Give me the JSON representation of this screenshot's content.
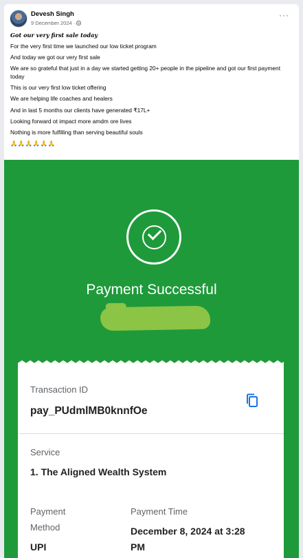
{
  "post": {
    "author": "Devesh Singh",
    "date": "9 December 2024",
    "separator": "·",
    "more_label": "···",
    "lines": [
      "For the very first time we launched our low ticket program",
      "And today we got our very first sale",
      "We are so grateful that just in a day we started getting 20+ people in the pipeline and got our first payment today",
      "This is our very first low ticket offering",
      "We are helping life coaches and healers",
      "And in last 5 months our clients have generated ₹17L+",
      "Looking forward ot impact more amdm ore lives",
      "Nothing is more fulfilling than serving beautiful souls"
    ],
    "lead": "Got our very first sale today",
    "emojis": "🙏🙏🙏🙏🙏🙏"
  },
  "receipt": {
    "status": "Payment Successful",
    "transaction_id_label": "Transaction ID",
    "transaction_id": "pay_PUdmlMB0knnfOe",
    "service_label": "Service",
    "service_value": "1. The Aligned Wealth System",
    "payment_method_label_1": "Payment",
    "payment_method_label_2": "Method",
    "payment_method_value": "UPI",
    "payment_time_label": "Payment Time",
    "payment_time_value_1": "December 8, 2024 at 3:28",
    "payment_time_value_2": "PM"
  },
  "colors": {
    "success_green": "#1e9a3a",
    "redaction_green": "#8cc445",
    "copy_icon_blue": "#1a73e8"
  },
  "icons": [
    "avatar",
    "globe-icon",
    "more-icon",
    "check-circle-icon",
    "copy-icon"
  ]
}
